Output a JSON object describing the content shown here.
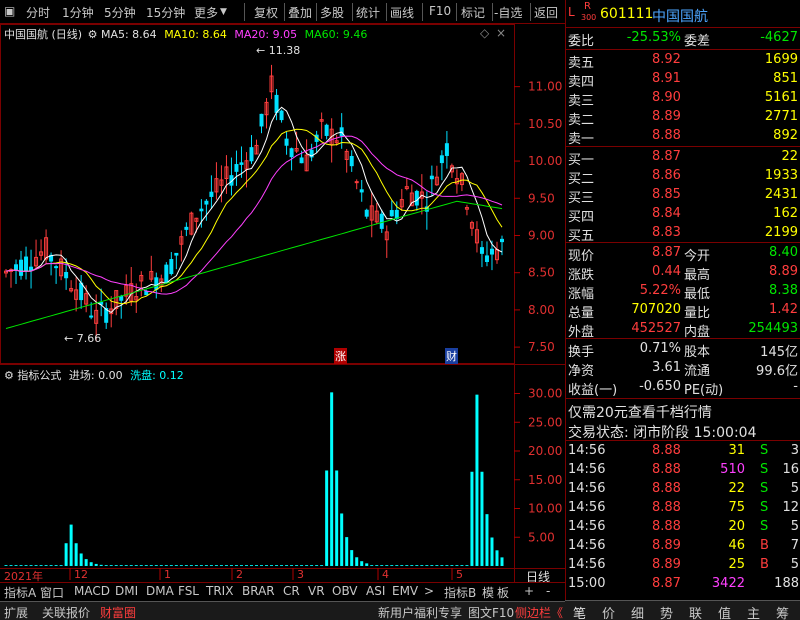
{
  "toolbar": {
    "left": [
      "分时",
      "1分钟",
      "5分钟",
      "15分钟",
      "更多"
    ],
    "right": [
      "复权",
      "叠加",
      "多股",
      "统计",
      "画线",
      "F10",
      "标记",
      "-自选",
      "返回"
    ]
  },
  "chart": {
    "title": "中国国航 (日线)",
    "ma5": "MA5: 8.64",
    "ma10": "MA10: 8.64",
    "ma20": "MA20: 9.05",
    "ma60": "MA60: 9.46",
    "high_label": "11.38",
    "low_label": "7.66",
    "price_axis": [
      "11.00",
      "10.50",
      "10.00",
      "9.50",
      "9.00",
      "8.50",
      "8.00",
      "7.50"
    ],
    "event_markers": [
      "涨",
      "财"
    ],
    "indicator_title": "指标公式",
    "indicator_in": "进场: 0.00",
    "indicator_out": "洗盘: 0.12",
    "vol_axis": [
      "30.00",
      "25.00",
      "20.00",
      "15.00",
      "10.00",
      "5.00"
    ],
    "date_axis": [
      "2021年",
      "12",
      "1",
      "2",
      "3",
      "4",
      "5"
    ],
    "period_label": "日线"
  },
  "tabs": [
    "指标A",
    "窗口",
    "MACD",
    "DMI",
    "DMA",
    "FSL",
    "TRIX",
    "BRAR",
    "CR",
    "VR",
    "OBV",
    "ASI",
    "EMV",
    "指标B",
    "模",
    "板"
  ],
  "tab_arrows": [
    ">",
    "+",
    "-"
  ],
  "statusbar": {
    "items": [
      "扩展",
      "关联报价",
      "财富圈"
    ],
    "right": [
      "新用户福利专享",
      "图文F10",
      "侧边栏《"
    ]
  },
  "quote": {
    "header_l": "L",
    "header_r": "R",
    "header_r_sub": "300",
    "code": "601111",
    "name": "中国国航",
    "weibi_label": "委比",
    "weibi": "-25.53%",
    "weicha_label": "委差",
    "weicha": "-4627",
    "sells": [
      {
        "label": "卖五",
        "price": "8.92",
        "vol": "1699"
      },
      {
        "label": "卖四",
        "price": "8.91",
        "vol": "851"
      },
      {
        "label": "卖三",
        "price": "8.90",
        "vol": "5161"
      },
      {
        "label": "卖二",
        "price": "8.89",
        "vol": "2771"
      },
      {
        "label": "卖一",
        "price": "8.88",
        "vol": "892"
      }
    ],
    "buys": [
      {
        "label": "买一",
        "price": "8.87",
        "vol": "22"
      },
      {
        "label": "买二",
        "price": "8.86",
        "vol": "1933"
      },
      {
        "label": "买三",
        "price": "8.85",
        "vol": "2431"
      },
      {
        "label": "买四",
        "price": "8.84",
        "vol": "162"
      },
      {
        "label": "买五",
        "price": "8.83",
        "vol": "2199"
      }
    ],
    "stats": [
      {
        "l1": "现价",
        "v1": "8.87",
        "c1": "red",
        "l2": "今开",
        "v2": "8.40",
        "c2": "green"
      },
      {
        "l1": "涨跌",
        "v1": "0.44",
        "c1": "red",
        "l2": "最高",
        "v2": "8.89",
        "c2": "red"
      },
      {
        "l1": "涨幅",
        "v1": "5.22%",
        "c1": "red",
        "l2": "最低",
        "v2": "8.38",
        "c2": "green"
      },
      {
        "l1": "总量",
        "v1": "707020",
        "c1": "yellow",
        "l2": "量比",
        "v2": "1.42",
        "c2": "red"
      },
      {
        "l1": "外盘",
        "v1": "452527",
        "c1": "red",
        "l2": "内盘",
        "v2": "254493",
        "c2": "green"
      }
    ],
    "stats2": [
      {
        "l1": "换手",
        "v1": "0.71%",
        "l2": "股本",
        "v2": "145亿"
      },
      {
        "l1": "净资",
        "v1": "3.61",
        "l2": "流通",
        "v2": "99.6亿"
      },
      {
        "l1": "收益(一)",
        "v1": "-0.650",
        "l2": "PE(动)",
        "v2": "-"
      }
    ],
    "promo": "仅需20元查看千档行情",
    "trade_status": "交易状态: 闭市阶段 15:00:04",
    "ticks": [
      {
        "t": "14:56",
        "p": "8.88",
        "v": "31",
        "vc": "yellow",
        "d": "S",
        "dc": "green",
        "n": "3"
      },
      {
        "t": "14:56",
        "p": "8.88",
        "v": "510",
        "vc": "mag",
        "d": "S",
        "dc": "green",
        "n": "16"
      },
      {
        "t": "14:56",
        "p": "8.88",
        "v": "22",
        "vc": "yellow",
        "d": "S",
        "dc": "green",
        "n": "5"
      },
      {
        "t": "14:56",
        "p": "8.88",
        "v": "75",
        "vc": "yellow",
        "d": "S",
        "dc": "green",
        "n": "12"
      },
      {
        "t": "14:56",
        "p": "8.88",
        "v": "20",
        "vc": "yellow",
        "d": "S",
        "dc": "green",
        "n": "5"
      },
      {
        "t": "14:56",
        "p": "8.89",
        "v": "46",
        "vc": "yellow",
        "d": "B",
        "dc": "red",
        "n": "7"
      },
      {
        "t": "14:56",
        "p": "8.89",
        "v": "25",
        "vc": "yellow",
        "d": "B",
        "dc": "red",
        "n": "5"
      },
      {
        "t": "15:00",
        "p": "8.87",
        "v": "3422",
        "vc": "mag",
        "d": "",
        "dc": "red",
        "n": "188"
      }
    ],
    "bottom_tabs": [
      "笔",
      "价",
      "细",
      "势",
      "联",
      "值",
      "主",
      "筹"
    ]
  },
  "chart_data": {
    "type": "candlestick",
    "title": "中国国航 (日线)",
    "ylim": [
      7.3,
      11.6
    ],
    "y_ticks": [
      11.0,
      10.5,
      10.0,
      9.5,
      9.0,
      8.5,
      8.0,
      7.5
    ],
    "high": 11.38,
    "low": 7.66,
    "series": [
      {
        "name": "MA5",
        "last": 8.64
      },
      {
        "name": "MA10",
        "last": 8.64
      },
      {
        "name": "MA20",
        "last": 9.05
      },
      {
        "name": "MA60",
        "last": 9.46
      }
    ],
    "indicator": {
      "ylim": [
        0,
        32
      ],
      "y_ticks": [
        30,
        25,
        20,
        15,
        10,
        5
      ],
      "spikes": [
        7.2,
        30.2,
        29.8
      ]
    }
  }
}
